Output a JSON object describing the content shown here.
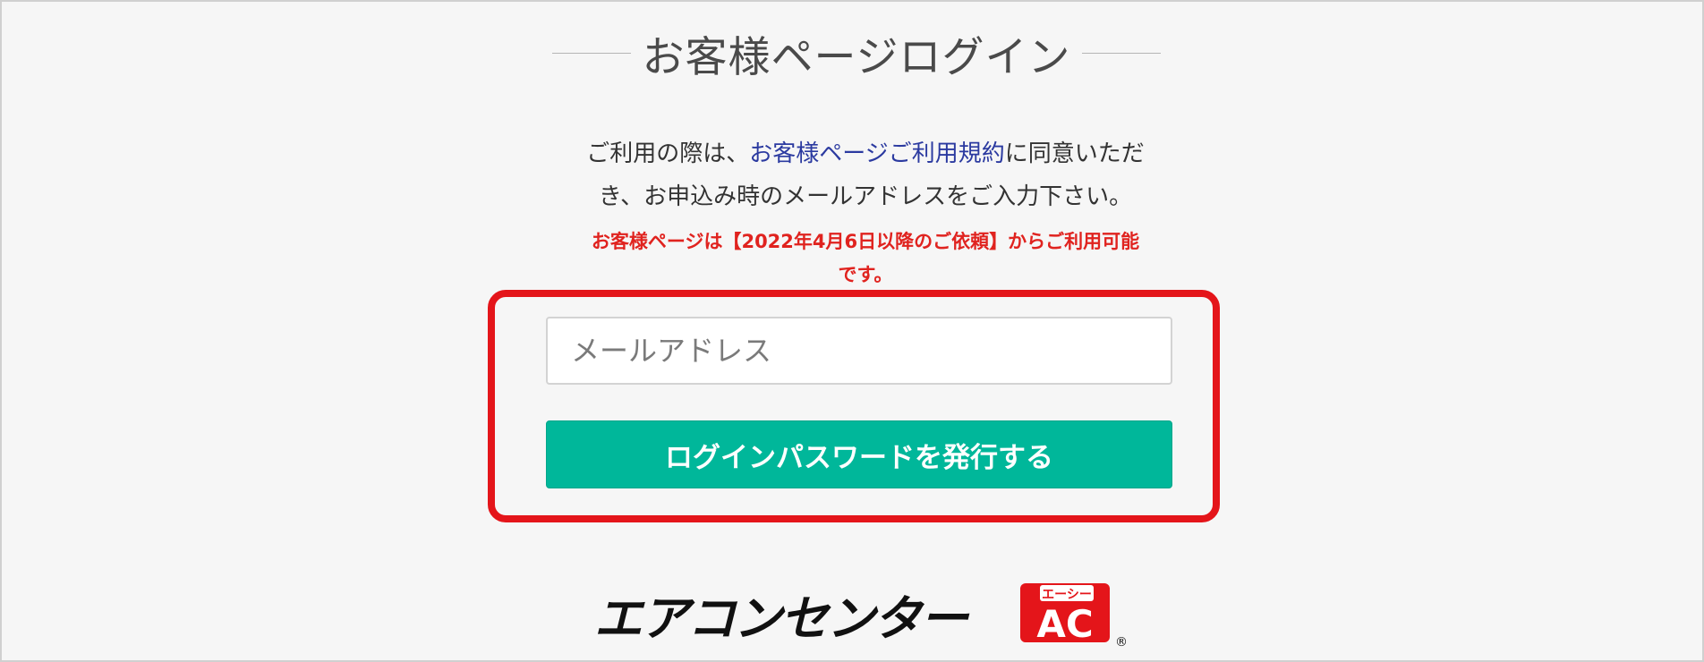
{
  "page": {
    "title": "お客様ページログイン"
  },
  "intro": {
    "prefix": "ご利用の際は、",
    "terms_link": "お客様ページご利用規約",
    "suffix_line1": "に同意いただ",
    "line2": "き、お申込み時のメールアドレスをご入力下さい。"
  },
  "notice": {
    "line1": "お客様ページは【2022年4月6日以降のご依頼】からご利用可能",
    "line2": "です。"
  },
  "form": {
    "email_placeholder": "メールアドレス",
    "email_value": "",
    "submit_label": "ログインパスワードを発行する"
  },
  "logo": {
    "wordmark": "エアコンセンター",
    "badge_top": "エーシー",
    "badge_letters": "AC",
    "registered": "®"
  },
  "colors": {
    "accent_button": "#00b79a",
    "highlight_border": "#e4151a",
    "notice_text": "#e0231f",
    "link_text": "#2b3aa0",
    "background": "#f6f6f6"
  }
}
